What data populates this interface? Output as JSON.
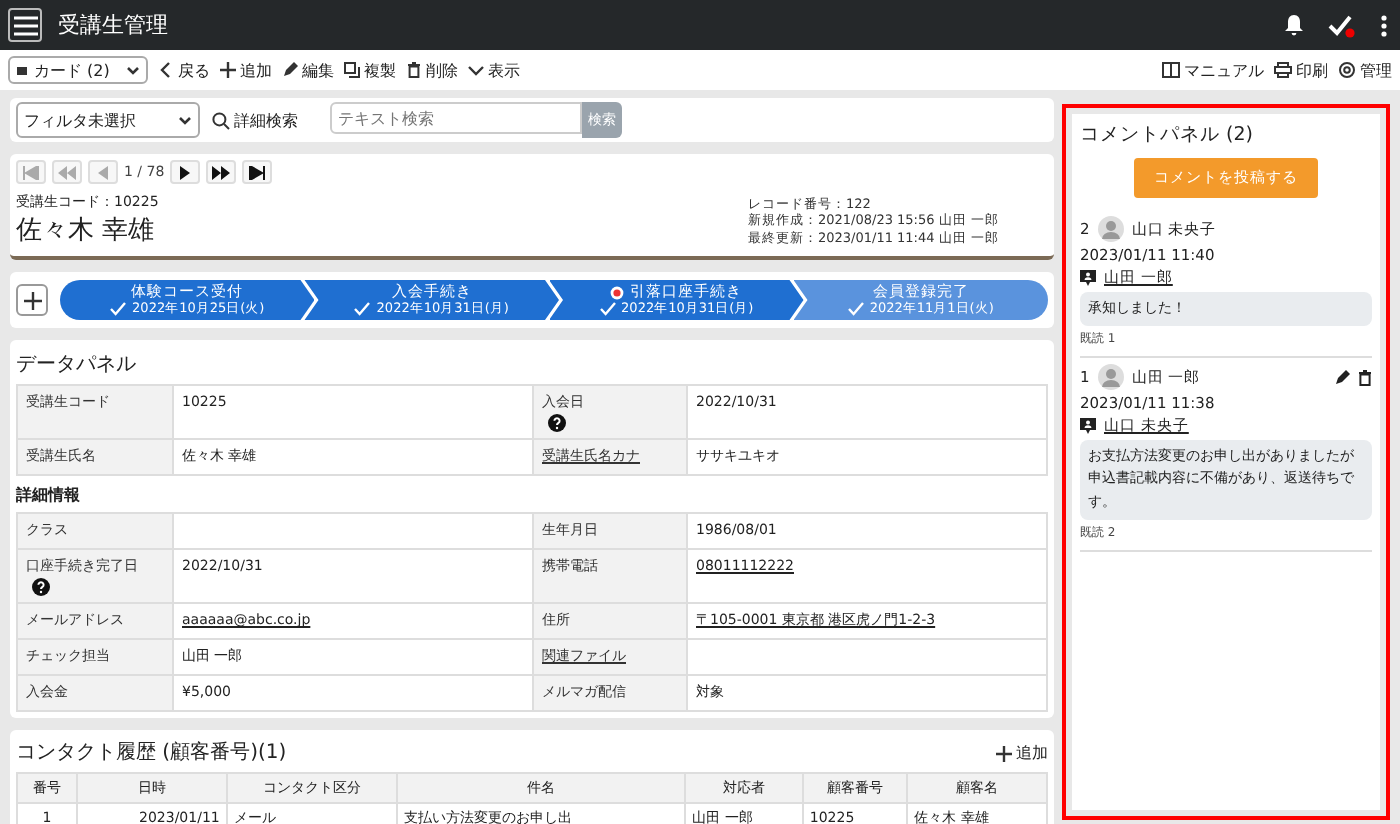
{
  "app_bar": {
    "title": "受講生管理",
    "has_notification": true
  },
  "toolbar": {
    "view": "カード (2)",
    "actions": [
      {
        "kind": "back",
        "label": "戻る"
      },
      {
        "kind": "add",
        "label": "追加"
      },
      {
        "kind": "edit",
        "label": "編集"
      },
      {
        "kind": "copy",
        "label": "複製"
      },
      {
        "kind": "delete",
        "label": "削除"
      },
      {
        "kind": "view",
        "label": "表示"
      }
    ],
    "right_actions": [
      {
        "kind": "manual",
        "label": "マニュアル"
      },
      {
        "kind": "print",
        "label": "印刷"
      },
      {
        "kind": "admin",
        "label": "管理"
      }
    ]
  },
  "filter": {
    "select": "フィルタ未選択",
    "advanced": "詳細検索",
    "placeholder": "テキスト検索",
    "button": "検索"
  },
  "pager": {
    "position": "1 / 78",
    "can_go_back": false,
    "can_go_forward": true
  },
  "record": {
    "code": "受講生コード：10225",
    "name": "佐々木 幸雄",
    "meta": [
      "レコード番号：122",
      "新規作成：2021/08/23 15:56 山田 一郎",
      "最終更新：2023/01/11 11:44 山田 一郎"
    ]
  },
  "steps": [
    {
      "label": "体験コース受付",
      "date": "2022年10月25日(火)",
      "current": false,
      "alert": false
    },
    {
      "label": "入会手続き",
      "date": "2022年10月31日(月)",
      "current": false,
      "alert": false
    },
    {
      "label": "引落口座手続き",
      "date": "2022年10月31日(月)",
      "current": false,
      "alert": true
    },
    {
      "label": "会員登録完了",
      "date": "2022年11月1日(火)",
      "current": true,
      "alert": false
    }
  ],
  "data_panel": {
    "title": "データパネル",
    "sections": [
      {
        "rows": [
          [
            {
              "label": "受講生コード",
              "value": "10225"
            },
            {
              "label": "入会日",
              "help": true,
              "value": "2022/10/31"
            }
          ],
          [
            {
              "label": "受講生氏名",
              "value": "佐々木 幸雄"
            },
            {
              "label": "受講生氏名カナ",
              "label_link": true,
              "value": "ササキユキオ"
            }
          ]
        ]
      },
      {
        "heading": "詳細情報",
        "rows": [
          [
            {
              "label": "クラス"
            },
            {
              "label": "生年月日",
              "value": "1986/08/01"
            }
          ],
          [
            {
              "label": "口座手続き完了日",
              "help": true,
              "value": "2022/10/31"
            },
            {
              "label": "携帯電話",
              "value": "08011112222",
              "value_link": true
            }
          ],
          [
            {
              "label": "メールアドレス",
              "value": "aaaaaa@abc.co.jp",
              "value_link": true
            },
            {
              "label": "住所",
              "value": "〒105-0001 東京都 港区虎ノ門1-2-3",
              "value_link": true
            }
          ],
          [
            {
              "label": "チェック担当",
              "value": "山田 一郎"
            },
            {
              "label": "関連ファイル",
              "label_link": true
            }
          ],
          [
            {
              "label": "入会金",
              "value": "¥5,000"
            },
            {
              "label": "メルマガ配信",
              "value": "対象"
            }
          ]
        ]
      }
    ]
  },
  "contact": {
    "title": "コンタクト履歴 (顧客番号)(1)",
    "add": "追加",
    "columns": [
      "番号",
      "日時",
      "コンタクト区分",
      "件名",
      "対応者",
      "顧客番号",
      "顧客名"
    ],
    "rows": [
      [
        "1",
        "2023/01/11",
        "メール",
        "支払い方法変更のお申し出",
        "山田 一郎",
        "10225",
        "佐々木 幸雄"
      ]
    ]
  },
  "comments": {
    "title": "コメントパネル (2)",
    "post": "コメントを投稿する",
    "items": [
      {
        "number": "2",
        "author": "山口 未央子",
        "time": "2023/01/11 11:40",
        "mention": "山田 一郎",
        "body": "承知しました！",
        "read": "既読 1",
        "own": false
      },
      {
        "number": "1",
        "author": "山田 一郎",
        "time": "2023/01/11 11:38",
        "mention": "山口 未央子",
        "body": "お支払方法変更のお申し出がありましたが申込書記載内容に不備があり、返送待ちです。",
        "read": "既読 2",
        "own": true
      }
    ]
  }
}
